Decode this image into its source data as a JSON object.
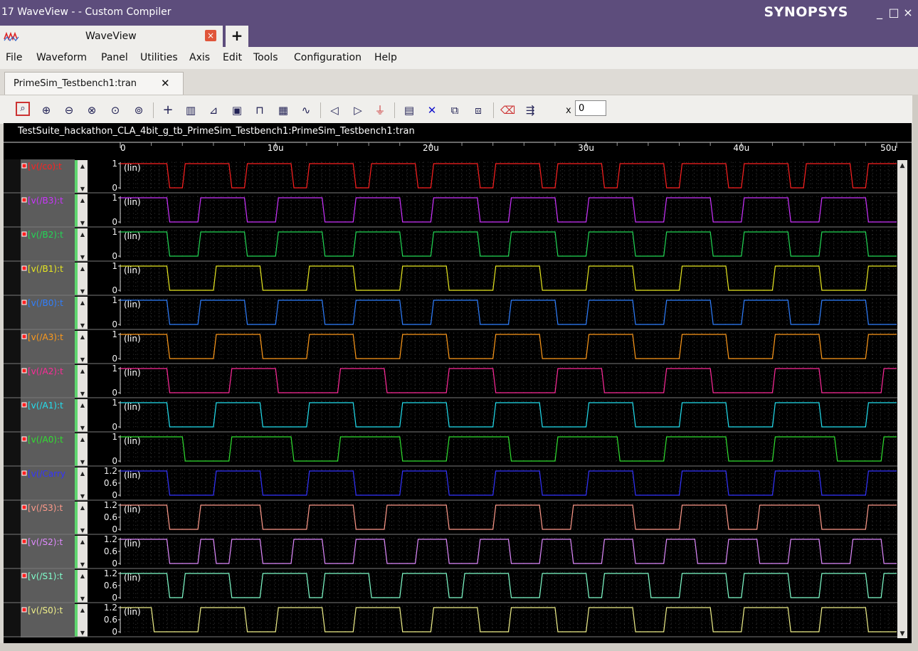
{
  "window": {
    "title": "17 WaveView -  - Custom Compiler",
    "brand": "SYNOPSYS",
    "controls": {
      "minimize": "_",
      "maximize": "□",
      "close": "×"
    }
  },
  "app_tab": {
    "icon": "waveform-app-icon",
    "label": "WaveView",
    "close": "×",
    "new_tab": "+"
  },
  "menu": [
    "File",
    "Waveform",
    "Panel",
    "Utilities",
    "Axis",
    "Edit",
    "Tools",
    "Configuration",
    "Help"
  ],
  "doc_tab": {
    "label": "PrimeSim_Testbench1:tran",
    "close": "✕"
  },
  "toolbar": {
    "icons": [
      "zoom-fit-icon",
      "zoom-in-icon",
      "zoom-out-icon",
      "zoom-in-x-icon",
      "zoom-box-icon",
      "zoom-previous-icon",
      "crosshair-icon",
      "stack-icon",
      "measure-icon",
      "marker-icon",
      "pulse-icon",
      "grid-icon",
      "waveform-icon",
      "previous-edge-icon",
      "next-edge-icon",
      "event-icon",
      "panel-icon",
      "delete-icon",
      "split-icon",
      "merge-icon",
      "eraser-icon",
      "export-icon"
    ],
    "x_label": "x",
    "x_value": "0"
  },
  "panel": {
    "title": "TestSuite_hackathon_CLA_4bit_g_tb_PrimeSim_Testbench1:PrimeSim_Testbench1:tran",
    "x_ticks": [
      "0",
      "10u",
      "20u",
      "30u",
      "40u",
      "50u"
    ],
    "scale_label": "(lin)"
  },
  "signals": [
    {
      "label": "[v(/co):t",
      "color": "#ff2020",
      "ticks": [
        "1",
        "0"
      ]
    },
    {
      "label": "[v(/B3):t",
      "color": "#cc33ff",
      "ticks": [
        "1",
        "0"
      ]
    },
    {
      "label": "[v(/B2):t",
      "color": "#22d855",
      "ticks": [
        "1",
        "0"
      ]
    },
    {
      "label": "[v(/B1):t",
      "color": "#e8e820",
      "ticks": [
        "1",
        "0"
      ]
    },
    {
      "label": "[v(/B0):t",
      "color": "#2f7fff",
      "ticks": [
        "1",
        "0"
      ]
    },
    {
      "label": "[v(/A3):t",
      "color": "#ff9a1a",
      "ticks": [
        "1",
        "0"
      ]
    },
    {
      "label": "[v(/A2):t",
      "color": "#ff2a9a",
      "ticks": [
        "1",
        "0"
      ]
    },
    {
      "label": "[v(/A1):t",
      "color": "#22e0f0",
      "ticks": [
        "1",
        "0"
      ]
    },
    {
      "label": "[v(/A0):t",
      "color": "#30e030",
      "ticks": [
        "1",
        "0"
      ]
    },
    {
      "label": "[v(/Carry",
      "color": "#3333ff",
      "ticks": [
        "1.2",
        "0.6",
        "0"
      ]
    },
    {
      "label": "[v(/S3):t",
      "color": "#ff9a8a",
      "ticks": [
        "1.2",
        "0.6",
        "0"
      ]
    },
    {
      "label": "[v(/S2):t",
      "color": "#e08aff",
      "ticks": [
        "1.2",
        "0.6",
        "0"
      ]
    },
    {
      "label": "[v(/S1):t",
      "color": "#80ffcc",
      "ticks": [
        "1.2",
        "0.6",
        "0"
      ]
    },
    {
      "label": "[v(/S0):t",
      "color": "#f0f08a",
      "ticks": [
        "1.2",
        "0.6",
        "0"
      ]
    }
  ],
  "chart_data": {
    "type": "line",
    "xlabel": "",
    "xlim": [
      0,
      50
    ],
    "x_unit": "u",
    "series": [
      {
        "name": "v(/co)",
        "transitions": [
          [
            0,
            1
          ],
          [
            3,
            0
          ],
          [
            4,
            1
          ],
          [
            7,
            0
          ],
          [
            8,
            1
          ],
          [
            11,
            0
          ],
          [
            12,
            1
          ],
          [
            15,
            0
          ],
          [
            16,
            1
          ],
          [
            19,
            0
          ],
          [
            20,
            1
          ],
          [
            23,
            0
          ],
          [
            24,
            1
          ],
          [
            27,
            0
          ],
          [
            28,
            1
          ],
          [
            31,
            0
          ],
          [
            32,
            1
          ],
          [
            35,
            0
          ],
          [
            36,
            1
          ],
          [
            39,
            0
          ],
          [
            40,
            1
          ],
          [
            43,
            0
          ],
          [
            44,
            1
          ],
          [
            47,
            0
          ],
          [
            48,
            1
          ]
        ]
      },
      {
        "name": "v(/B3)",
        "transitions": [
          [
            0,
            1
          ],
          [
            3,
            0
          ],
          [
            5,
            1
          ],
          [
            8,
            0
          ],
          [
            10,
            1
          ],
          [
            13,
            0
          ],
          [
            15,
            1
          ],
          [
            18,
            0
          ],
          [
            20,
            1
          ],
          [
            23,
            0
          ],
          [
            25,
            1
          ],
          [
            28,
            0
          ],
          [
            30,
            1
          ],
          [
            33,
            0
          ],
          [
            35,
            1
          ],
          [
            38,
            0
          ],
          [
            40,
            1
          ],
          [
            43,
            0
          ],
          [
            45,
            1
          ],
          [
            48,
            0
          ]
        ]
      },
      {
        "name": "v(/B2)",
        "transitions": [
          [
            0,
            1
          ],
          [
            3,
            0
          ],
          [
            5,
            1
          ],
          [
            8,
            0
          ],
          [
            10,
            1
          ],
          [
            13,
            0
          ],
          [
            15,
            1
          ],
          [
            18,
            0
          ],
          [
            20,
            1
          ],
          [
            23,
            0
          ],
          [
            25,
            1
          ],
          [
            28,
            0
          ],
          [
            30,
            1
          ],
          [
            33,
            0
          ],
          [
            35,
            1
          ],
          [
            38,
            0
          ],
          [
            40,
            1
          ],
          [
            43,
            0
          ],
          [
            45,
            1
          ],
          [
            48,
            0
          ]
        ]
      },
      {
        "name": "v(/B1)",
        "transitions": [
          [
            0,
            1
          ],
          [
            3,
            0
          ],
          [
            6,
            1
          ],
          [
            9,
            0
          ],
          [
            12,
            1
          ],
          [
            15,
            0
          ],
          [
            18,
            1
          ],
          [
            21,
            0
          ],
          [
            24,
            1
          ],
          [
            27,
            0
          ],
          [
            30,
            1
          ],
          [
            33,
            0
          ],
          [
            36,
            1
          ],
          [
            39,
            0
          ],
          [
            42,
            1
          ],
          [
            45,
            0
          ],
          [
            48,
            1
          ]
        ]
      },
      {
        "name": "v(/B0)",
        "transitions": [
          [
            0,
            1
          ],
          [
            3,
            0
          ],
          [
            5,
            1
          ],
          [
            8,
            0
          ],
          [
            10,
            1
          ],
          [
            13,
            0
          ],
          [
            15,
            1
          ],
          [
            18,
            0
          ],
          [
            20,
            1
          ],
          [
            23,
            0
          ],
          [
            25,
            1
          ],
          [
            28,
            0
          ],
          [
            30,
            1
          ],
          [
            33,
            0
          ],
          [
            35,
            1
          ],
          [
            38,
            0
          ],
          [
            40,
            1
          ],
          [
            43,
            0
          ],
          [
            45,
            1
          ],
          [
            48,
            0
          ]
        ]
      },
      {
        "name": "v(/A3)",
        "transitions": [
          [
            0,
            1
          ],
          [
            3,
            0
          ],
          [
            6,
            1
          ],
          [
            9,
            0
          ],
          [
            12,
            1
          ],
          [
            15,
            0
          ],
          [
            18,
            1
          ],
          [
            21,
            0
          ],
          [
            24,
            1
          ],
          [
            27,
            0
          ],
          [
            30,
            1
          ],
          [
            33,
            0
          ],
          [
            36,
            1
          ],
          [
            39,
            0
          ],
          [
            42,
            1
          ],
          [
            45,
            0
          ],
          [
            48,
            1
          ]
        ]
      },
      {
        "name": "v(/A2)",
        "transitions": [
          [
            0,
            1
          ],
          [
            3,
            0
          ],
          [
            7,
            1
          ],
          [
            10,
            0
          ],
          [
            14,
            1
          ],
          [
            17,
            0
          ],
          [
            21,
            1
          ],
          [
            24,
            0
          ],
          [
            28,
            1
          ],
          [
            31,
            0
          ],
          [
            35,
            1
          ],
          [
            38,
            0
          ],
          [
            42,
            1
          ],
          [
            45,
            0
          ],
          [
            49,
            1
          ]
        ]
      },
      {
        "name": "v(/A1)",
        "transitions": [
          [
            0,
            1
          ],
          [
            3,
            0
          ],
          [
            6,
            1
          ],
          [
            9,
            0
          ],
          [
            12,
            1
          ],
          [
            15,
            0
          ],
          [
            18,
            1
          ],
          [
            21,
            0
          ],
          [
            24,
            1
          ],
          [
            27,
            0
          ],
          [
            30,
            1
          ],
          [
            33,
            0
          ],
          [
            36,
            1
          ],
          [
            39,
            0
          ],
          [
            42,
            1
          ],
          [
            45,
            0
          ],
          [
            48,
            1
          ]
        ]
      },
      {
        "name": "v(/A0)",
        "transitions": [
          [
            0,
            1
          ],
          [
            4,
            0
          ],
          [
            7,
            1
          ],
          [
            11,
            0
          ],
          [
            14,
            1
          ],
          [
            18,
            0
          ],
          [
            21,
            1
          ],
          [
            25,
            0
          ],
          [
            28,
            1
          ],
          [
            32,
            0
          ],
          [
            35,
            1
          ],
          [
            39,
            0
          ],
          [
            42,
            1
          ],
          [
            46,
            0
          ],
          [
            49,
            1
          ]
        ]
      },
      {
        "name": "v(/Carry)",
        "transitions": [
          [
            0,
            1.2
          ],
          [
            3,
            0
          ],
          [
            6,
            1.2
          ],
          [
            9,
            0
          ],
          [
            12,
            1.2
          ],
          [
            15,
            0
          ],
          [
            18,
            1.2
          ],
          [
            21,
            0
          ],
          [
            24,
            1.2
          ],
          [
            27,
            0
          ],
          [
            30,
            1.2
          ],
          [
            33,
            0
          ],
          [
            36,
            1.2
          ],
          [
            39,
            0
          ],
          [
            42,
            1.2
          ],
          [
            45,
            0
          ],
          [
            48,
            1.2
          ]
        ]
      },
      {
        "name": "v(/S3)",
        "transitions": [
          [
            0,
            1.2
          ],
          [
            3,
            0
          ],
          [
            5,
            1.2
          ],
          [
            9,
            0
          ],
          [
            12,
            1.2
          ],
          [
            15,
            0
          ],
          [
            17,
            1.2
          ],
          [
            21,
            0
          ],
          [
            24,
            1.2
          ],
          [
            27,
            0
          ],
          [
            29,
            1.2
          ],
          [
            33,
            0
          ],
          [
            36,
            1.2
          ],
          [
            39,
            0
          ],
          [
            41,
            1.2
          ],
          [
            45,
            0
          ],
          [
            48,
            1.2
          ]
        ]
      },
      {
        "name": "v(/S2)",
        "transitions": [
          [
            0,
            1.2
          ],
          [
            3,
            0
          ],
          [
            5,
            1.2
          ],
          [
            6,
            0
          ],
          [
            7,
            1.2
          ],
          [
            9,
            0
          ],
          [
            11,
            1.2
          ],
          [
            13,
            0
          ],
          [
            15,
            1.2
          ],
          [
            17,
            0
          ],
          [
            19,
            1.2
          ],
          [
            21,
            0
          ],
          [
            23,
            1.2
          ],
          [
            25,
            0
          ],
          [
            27,
            1.2
          ],
          [
            29,
            0
          ],
          [
            31,
            1.2
          ],
          [
            33,
            0
          ],
          [
            35,
            1.2
          ],
          [
            37,
            0
          ],
          [
            39,
            1.2
          ],
          [
            41,
            0
          ],
          [
            43,
            1.2
          ],
          [
            45,
            0
          ],
          [
            47,
            1.2
          ],
          [
            49,
            0
          ]
        ]
      },
      {
        "name": "v(/S1)",
        "transitions": [
          [
            0,
            1.2
          ],
          [
            3,
            0
          ],
          [
            4,
            1.2
          ],
          [
            7,
            0
          ],
          [
            9,
            1.2
          ],
          [
            12,
            0
          ],
          [
            13,
            1.2
          ],
          [
            16,
            0
          ],
          [
            18,
            1.2
          ],
          [
            21,
            0
          ],
          [
            22,
            1.2
          ],
          [
            25,
            0
          ],
          [
            27,
            1.2
          ],
          [
            30,
            0
          ],
          [
            31,
            1.2
          ],
          [
            34,
            0
          ],
          [
            36,
            1.2
          ],
          [
            39,
            0
          ],
          [
            40,
            1.2
          ],
          [
            43,
            0
          ],
          [
            45,
            1.2
          ],
          [
            48,
            0
          ],
          [
            49,
            1.2
          ]
        ]
      },
      {
        "name": "v(/S0)",
        "transitions": [
          [
            0,
            1.2
          ],
          [
            2,
            0
          ],
          [
            5,
            1.2
          ],
          [
            8,
            0
          ],
          [
            10,
            1.2
          ],
          [
            13,
            0
          ],
          [
            15,
            1.2
          ],
          [
            18,
            0
          ],
          [
            20,
            1.2
          ],
          [
            23,
            0
          ],
          [
            25,
            1.2
          ],
          [
            28,
            0
          ],
          [
            30,
            1.2
          ],
          [
            33,
            0
          ],
          [
            35,
            1.2
          ],
          [
            38,
            0
          ],
          [
            40,
            1.2
          ],
          [
            43,
            0
          ],
          [
            45,
            1.2
          ],
          [
            48,
            0
          ]
        ]
      }
    ]
  }
}
